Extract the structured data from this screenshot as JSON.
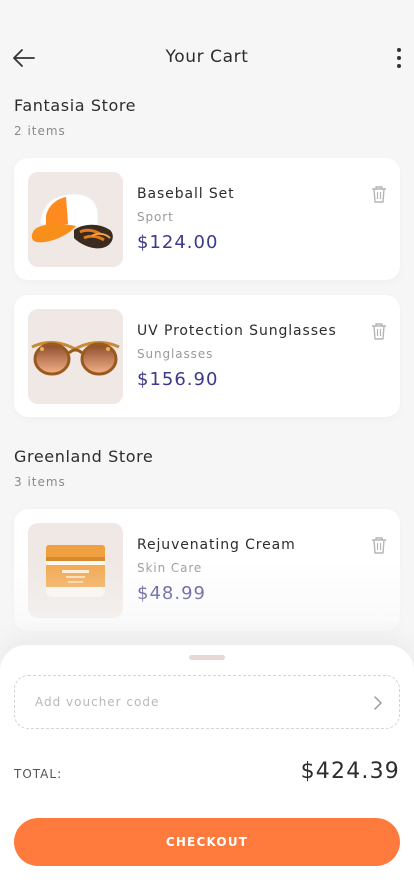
{
  "header": {
    "title": "Your Cart",
    "back_icon": "arrow-left-icon",
    "more_icon": "more-vertical-icon"
  },
  "stores": [
    {
      "name": "Fantasia Store",
      "count": "2 items",
      "items": [
        {
          "name": "Baseball Set",
          "category": "Sport",
          "price": "$124.00",
          "image_icon": "baseball-cap-icon"
        },
        {
          "name": "UV Protection Sunglasses",
          "category": "Sunglasses",
          "price": "$156.90",
          "image_icon": "sunglasses-icon"
        }
      ]
    },
    {
      "name": "Greenland Store",
      "count": "3 items",
      "items": [
        {
          "name": "Rejuvenating Cream",
          "category": "Skin Care",
          "price": "$48.99",
          "image_icon": "cream-jar-icon"
        }
      ]
    }
  ],
  "voucher": {
    "placeholder": "Add voucher code",
    "value": ""
  },
  "total": {
    "label": "TOTAL:",
    "value": "$424.39"
  },
  "checkout": {
    "label": "CHECKOUT"
  },
  "colors": {
    "accent": "#ff7a3d",
    "price": "#3c3a8a",
    "background": "#f6f6f6"
  }
}
